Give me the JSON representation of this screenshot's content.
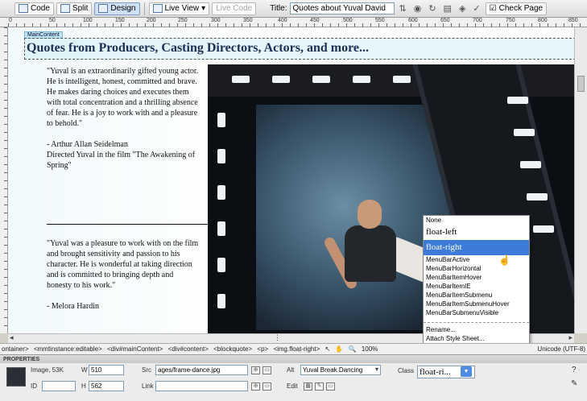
{
  "toolbar": {
    "code_label": "Code",
    "split_label": "Split",
    "design_label": "Design",
    "live_view_label": "Live View",
    "live_code_label": "Live Code",
    "title_label": "Title:",
    "title_value": "Quotes about Yuval David",
    "check_page_label": "Check Page"
  },
  "ruler": {
    "ticks": [
      "0",
      "50",
      "100",
      "150",
      "200",
      "250",
      "300",
      "350",
      "400",
      "450",
      "500",
      "550",
      "600",
      "650",
      "700",
      "750",
      "800",
      "850"
    ]
  },
  "canvas": {
    "maincontent_tab": "MainContent",
    "heading": "Quotes from Producers, Casting Directors, Actors, and more...",
    "quote1": {
      "text": "\"Yuval is an extraordinarily gifted young actor. He is intelligent, honest, committed and brave. He makes daring choices and executes them with total concentration and a thrilling absence of fear. He is a joy to work with and a pleasure to behold.\"",
      "attribution": "- Arthur Allan Seidelman",
      "credit": "Directed Yuval in the film \"The Awakening of Spring\""
    },
    "quote2": {
      "text": "\"Yuval was a pleasure to work with on the film and brought sensitivity and passion to his character. He is wonderful at taking direction and is committed to bringing depth and honesty to his work.\"",
      "attribution": "- Melora Hardin"
    }
  },
  "class_menu": {
    "items": [
      {
        "label": "None",
        "style": "small"
      },
      {
        "label": "float-left",
        "style": "big"
      },
      {
        "label": "float-right",
        "style": "big",
        "selected": true
      },
      {
        "label": "MenuBarActive",
        "style": "small"
      },
      {
        "label": "MenuBarHorizontal",
        "style": "small"
      },
      {
        "label": "MenuBarItemHover",
        "style": "small"
      },
      {
        "label": "MenuBarItemIE",
        "style": "small"
      },
      {
        "label": "MenuBarItemSubmenu",
        "style": "small"
      },
      {
        "label": "MenuBarItemSubmenuHover",
        "style": "small"
      },
      {
        "label": "MenuBarSubmenuVisible",
        "style": "small"
      },
      {
        "label": "",
        "style": "sep"
      },
      {
        "label": "Rename...",
        "style": "small"
      },
      {
        "label": "Attach Style Sheet...",
        "style": "small"
      }
    ]
  },
  "status_bar": {
    "tags": [
      "ontainer>",
      "<mmtinstance:editable>",
      "<div#mainContent>",
      "<div#content>",
      "<blockquote>",
      "<p>",
      "<img.float-right>"
    ],
    "zoom": "100%",
    "encoding": "Unicode (UTF-8)"
  },
  "properties": {
    "header": "PROPERTIES",
    "kind": "Image, 53K",
    "id_label": "ID",
    "id_value": "",
    "w_label": "W",
    "w_value": "510",
    "h_label": "H",
    "h_value": "562",
    "src_label": "Src",
    "src_value": "ages/frame-dance.jpg",
    "link_label": "Link",
    "link_value": "",
    "alt_label": "Alt",
    "alt_value": "Yuval Break Dancing",
    "edit_label": "Edit",
    "class_label": "Class",
    "class_value": "float-ri..."
  }
}
